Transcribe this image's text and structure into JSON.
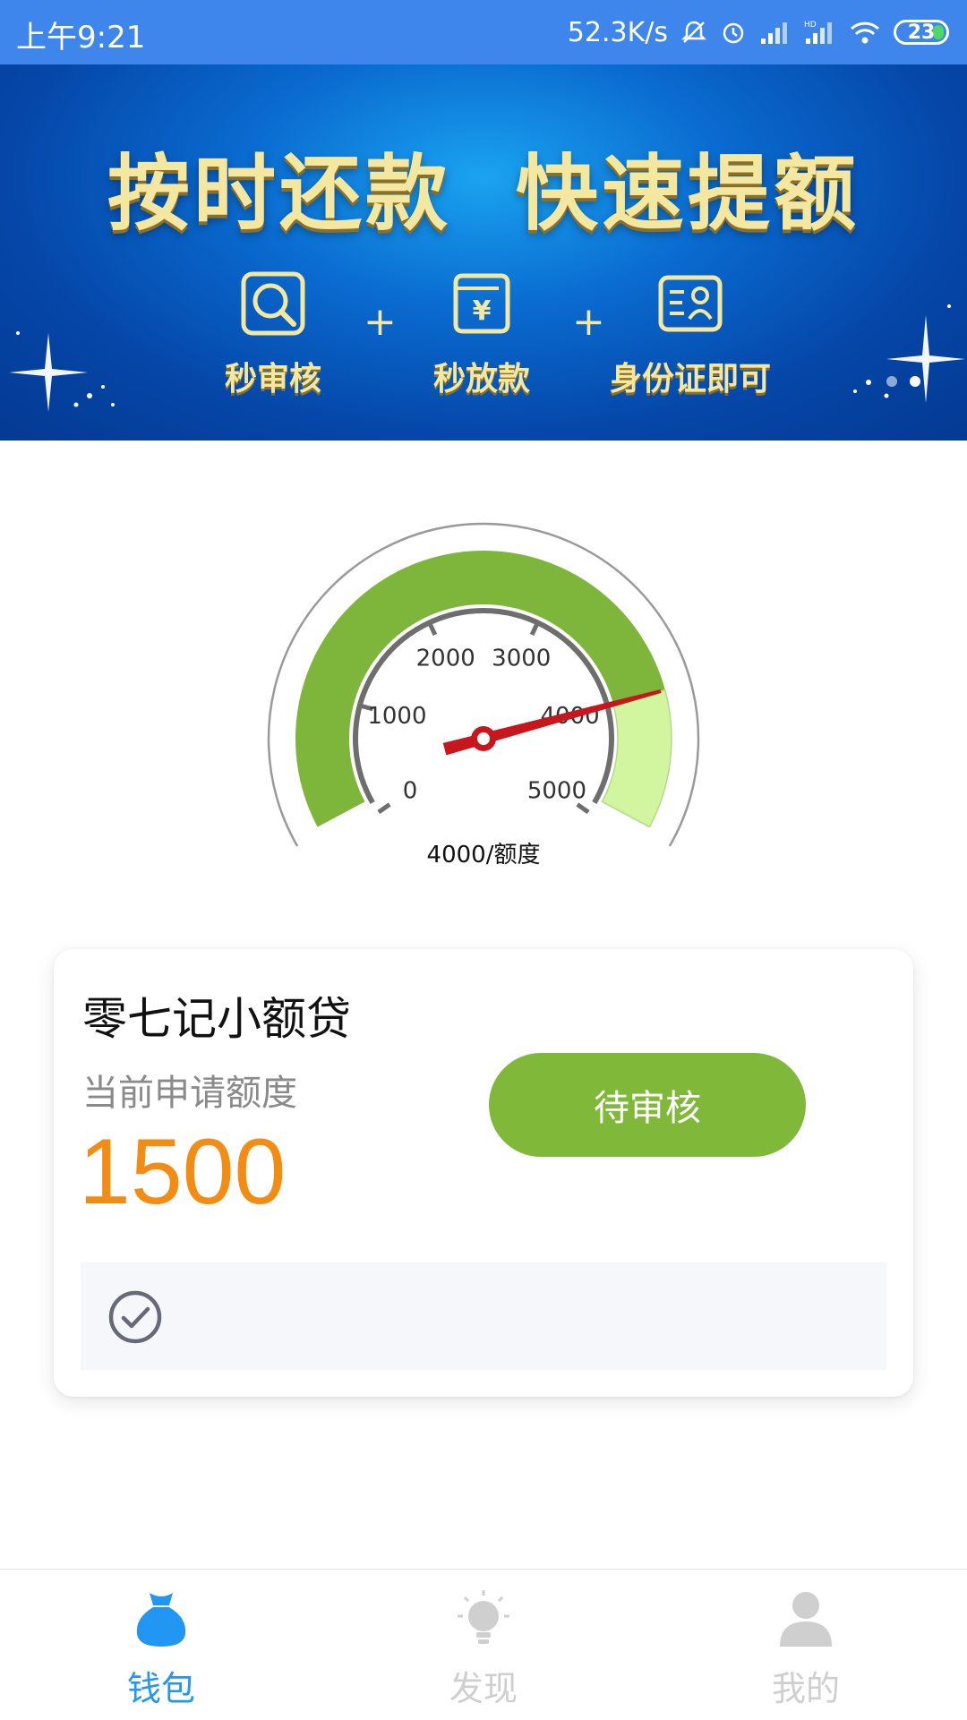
{
  "status_bar": {
    "time": "上午9:21",
    "network_speed": "52.3K/s",
    "battery": "23",
    "icons": [
      "mute-icon",
      "alarm-icon",
      "signal-icon",
      "hd-signal-icon",
      "wifi-icon",
      "battery-icon"
    ]
  },
  "banner": {
    "title": "按时还款  快速提额",
    "features": [
      {
        "label": "秒审核",
        "icon": "search-icon"
      },
      {
        "label": "秒放款",
        "icon": "yuan-wallet-icon"
      },
      {
        "label": "身份证即可",
        "icon": "id-card-icon"
      }
    ],
    "plus": "+",
    "page_indicator": {
      "count": 2,
      "active": 1
    }
  },
  "gauge": {
    "ticks": [
      "0",
      "1000",
      "2000",
      "3000",
      "4000",
      "5000"
    ],
    "min": 0,
    "max": 5000,
    "value": 4000,
    "caption": "4000/额度"
  },
  "loan_card": {
    "title": "零七记小额贷",
    "subtitle": "当前申请额度",
    "amount": "1500",
    "status_button": "待审核",
    "footer_icon": "check-circle-icon"
  },
  "tab_bar": {
    "items": [
      {
        "label": "钱包",
        "icon": "money-bag-icon",
        "active": true
      },
      {
        "label": "发现",
        "icon": "lightbulb-icon",
        "active": false
      },
      {
        "label": "我的",
        "icon": "user-icon",
        "active": false
      }
    ],
    "active_color": "#2196f3",
    "inactive_color": "#cfcfcf"
  },
  "colors": {
    "status_bar": "#3f86ec",
    "amount": "#f28c13",
    "button": "#80b83a",
    "gauge_arc": "#7db63a",
    "gauge_arc_light": "#d2f5a0",
    "needle": "#c8161d"
  }
}
